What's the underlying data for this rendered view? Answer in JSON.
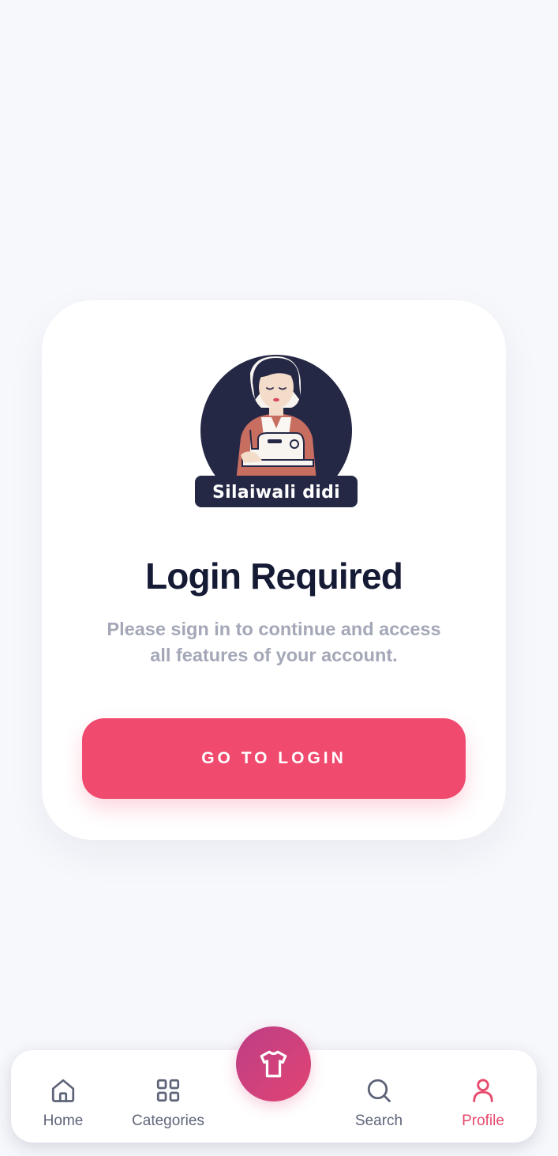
{
  "logo": {
    "brand_text": "Silaiwali didi"
  },
  "login_card": {
    "title": "Login Required",
    "subtitle": "Please sign in to continue and access all features of your account.",
    "button_label": "GO TO LOGIN"
  },
  "bottom_nav": {
    "items": [
      {
        "label": "Home",
        "icon": "home-icon",
        "active": false
      },
      {
        "label": "Categories",
        "icon": "grid-icon",
        "active": false
      },
      {
        "label": "Search",
        "icon": "search-icon",
        "active": false
      },
      {
        "label": "Profile",
        "icon": "user-icon",
        "active": true
      }
    ],
    "center_button_icon": "shirt-icon"
  },
  "colors": {
    "accent": "#f04a6e",
    "active_nav": "#e64a6c",
    "title": "#151a35",
    "subtitle": "#a3a7b7",
    "logo_circle": "#252845"
  }
}
